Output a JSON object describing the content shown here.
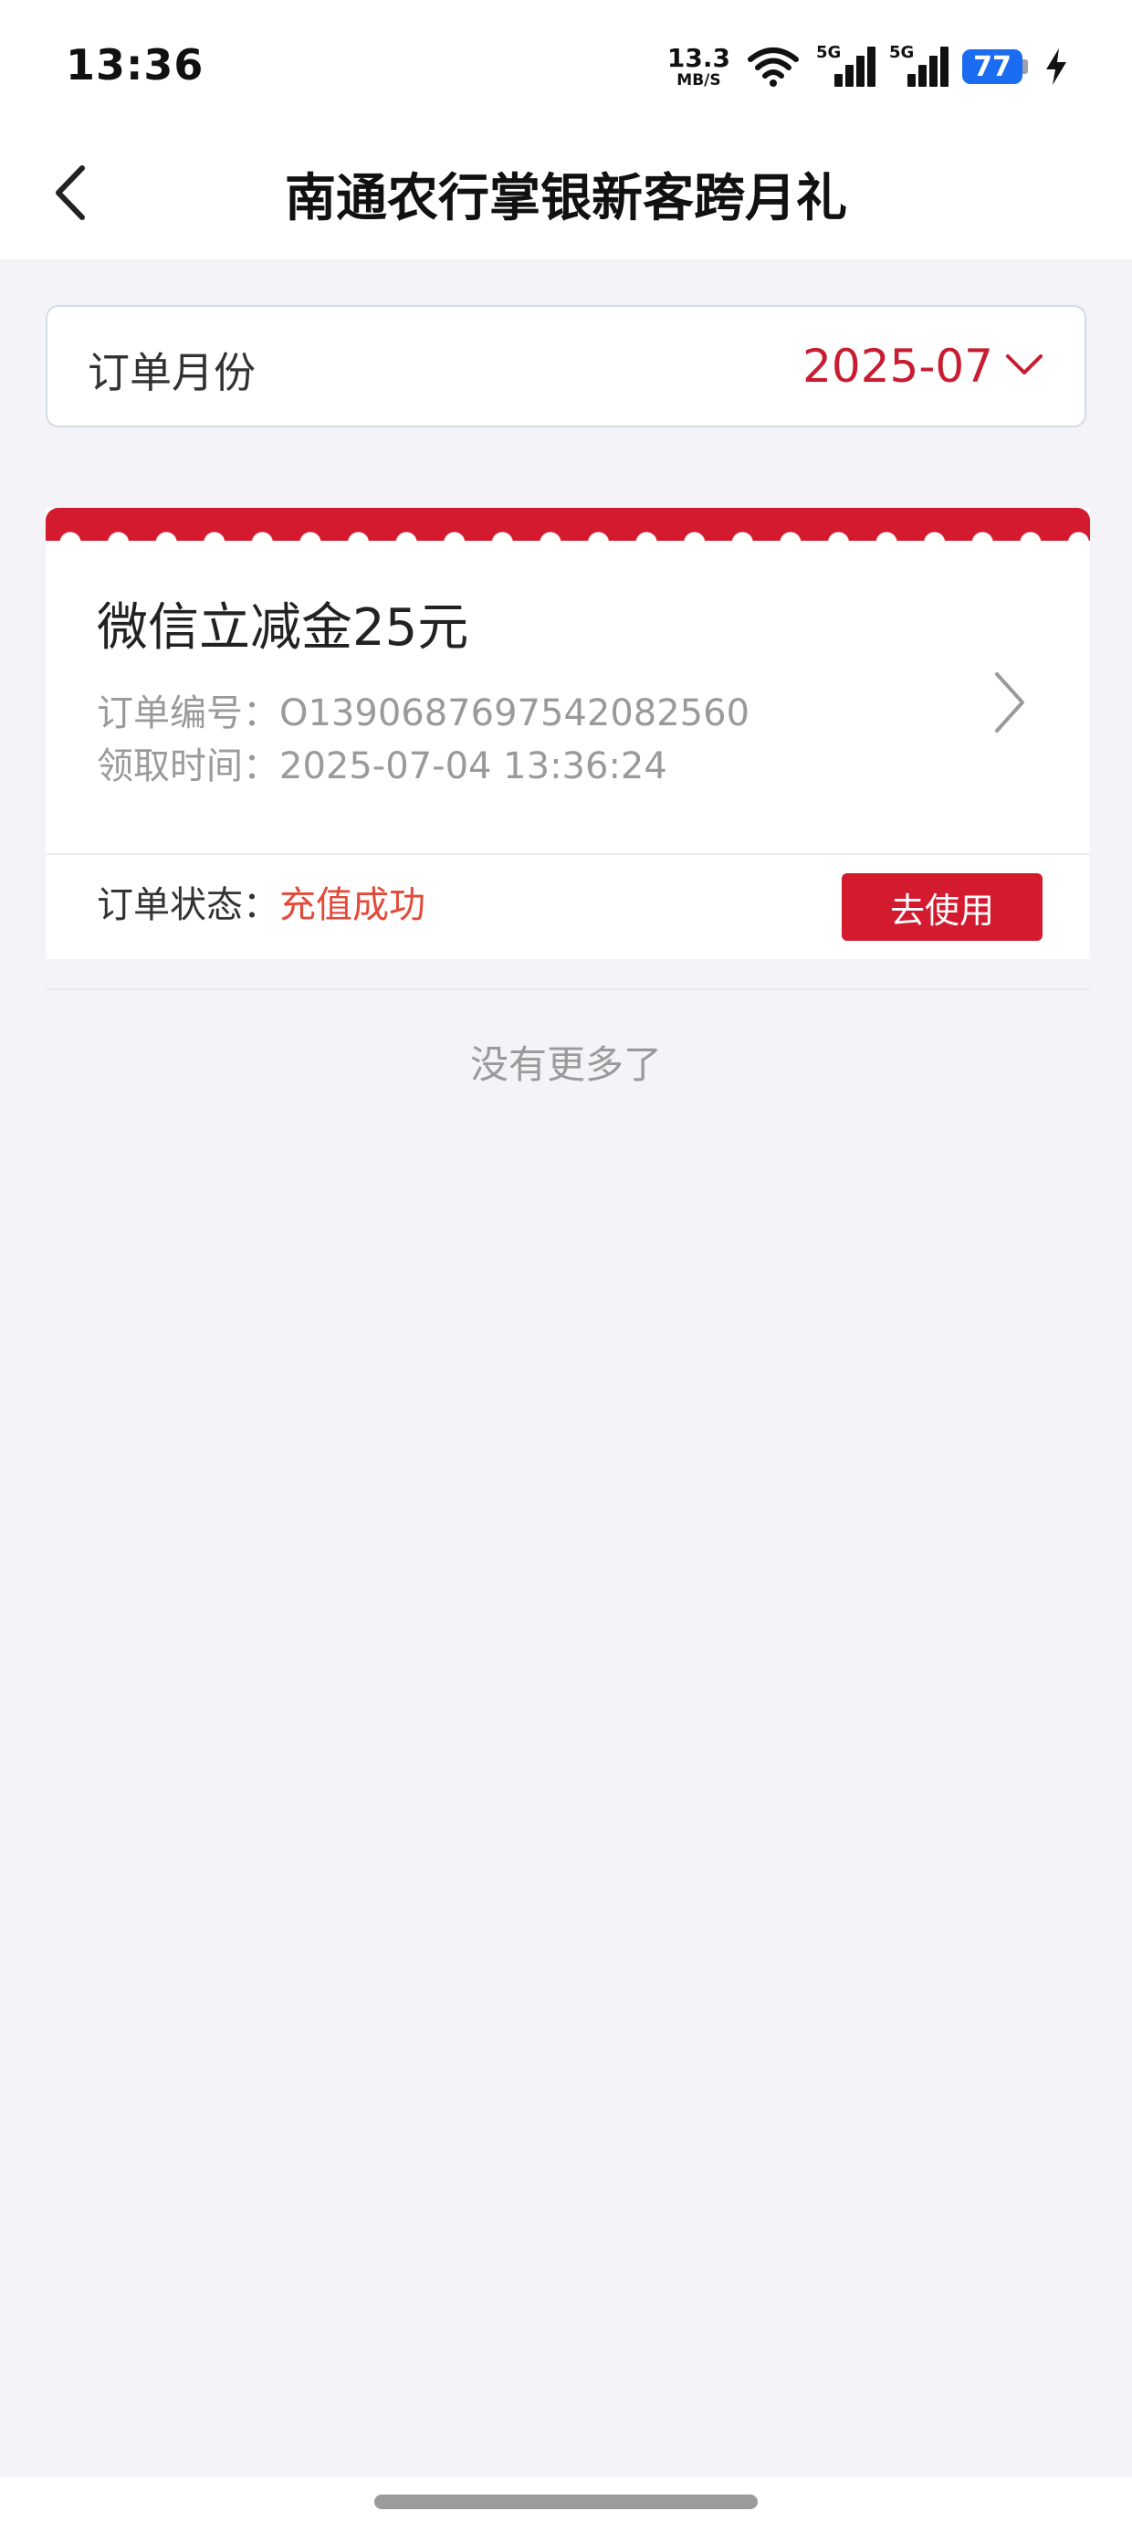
{
  "status_bar": {
    "time": "13:36",
    "net_speed": "13.3",
    "net_unit": "MB/S",
    "sim1_label": "5G",
    "sim2_label": "5G",
    "battery": "77",
    "icons": [
      "wifi-icon",
      "signal-5g-icon",
      "signal-5g-icon",
      "battery-icon",
      "charging-bolt-icon"
    ]
  },
  "header": {
    "title": "南通农行掌银新客跨月礼",
    "back_icon": "back-arrow-icon"
  },
  "month_filter": {
    "label": "订单月份",
    "value": "2025-07",
    "icon": "chevron-down-icon"
  },
  "orders": [
    {
      "title": "微信立减金25元",
      "order_no_label": "订单编号：",
      "order_no": "O1390687697542082560",
      "time_label": "领取时间：",
      "time": "2025-07-04 13:36:24",
      "status_label": "订单状态：",
      "status": "充值成功",
      "action": "去使用"
    }
  ],
  "list_end": "没有更多了",
  "colors": {
    "accent": "#d31a2f",
    "status_success": "#e34a3a",
    "background": "#f3f3f8"
  }
}
